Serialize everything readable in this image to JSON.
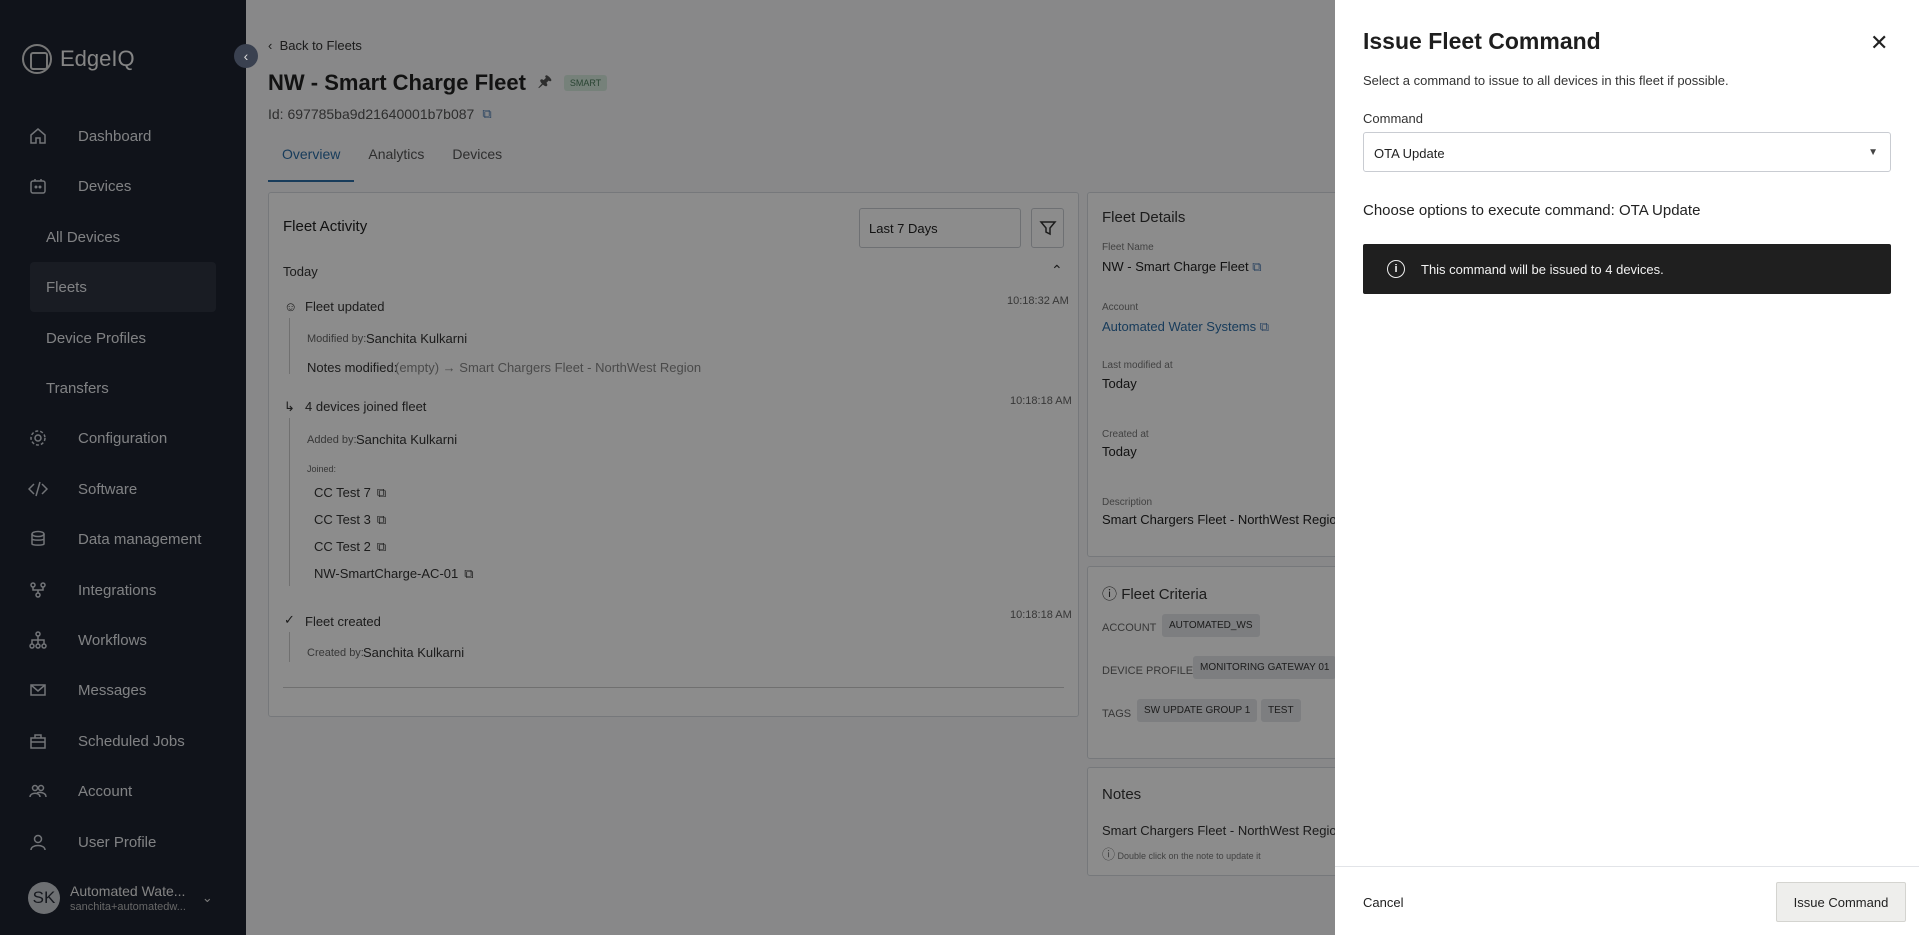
{
  "app": {
    "brand": "EdgeIQ"
  },
  "sidebar": {
    "items": [
      {
        "label": "Dashboard",
        "icon": "home-icon"
      },
      {
        "label": "Devices",
        "icon": "devices-icon"
      },
      {
        "label": "Configuration",
        "icon": "gear-icon"
      },
      {
        "label": "Software",
        "icon": "code-icon"
      },
      {
        "label": "Data management",
        "icon": "database-icon"
      },
      {
        "label": "Integrations",
        "icon": "integrations-icon"
      },
      {
        "label": "Workflows",
        "icon": "workflow-icon"
      },
      {
        "label": "Messages",
        "icon": "mail-icon"
      },
      {
        "label": "Scheduled Jobs",
        "icon": "briefcase-icon"
      },
      {
        "label": "Account",
        "icon": "people-icon"
      },
      {
        "label": "User Profile",
        "icon": "user-icon"
      }
    ],
    "sub_items": [
      "All Devices",
      "Fleets",
      "Device Profiles",
      "Transfers"
    ],
    "user": {
      "initials": "SK",
      "name": "Automated Wate...",
      "email": "sanchita+automatedw..."
    }
  },
  "page": {
    "back": "Back to Fleets",
    "title": "NW - Smart Charge Fleet",
    "badge": "SMART",
    "id_text": "Id: 697785ba9d21640001b7b087",
    "tabs": [
      "Overview",
      "Analytics",
      "Devices"
    ]
  },
  "activity": {
    "title": "Fleet Activity",
    "range": "Last 7 Days",
    "group": "Today",
    "events": {
      "updated": {
        "title": "Fleet updated",
        "time": "10:18:32 AM",
        "modified_by_label": "Modified by:",
        "modified_by": "Sanchita Kulkarni",
        "notes_label": "Notes modified:",
        "notes_from": "(empty) → Smart Chargers Fleet - NorthWest Region"
      },
      "joined": {
        "title": "4 devices joined fleet",
        "time": "10:18:18 AM",
        "added_by_label": "Added by:",
        "added_by": "Sanchita Kulkarni",
        "joined_label": "Joined:",
        "devices": [
          "CC Test 7",
          "CC Test 3",
          "CC Test 2",
          "NW-SmartCharge-AC-01"
        ]
      },
      "created": {
        "title": "Fleet created",
        "time": "10:18:18 AM",
        "created_by_label": "Created by:",
        "created_by": "Sanchita Kulkarni"
      }
    }
  },
  "details": {
    "title": "Fleet Details",
    "fleet_name_label": "Fleet Name",
    "fleet_name": "NW - Smart Charge Fleet",
    "account_label": "Account",
    "account": "Automated Water Systems",
    "last_modified_label": "Last modified at",
    "last_modified": "Today",
    "created_label": "Created at",
    "created": "Today",
    "description_label": "Description",
    "description": "Smart Chargers Fleet - NorthWest Region"
  },
  "criteria": {
    "title": "Fleet Criteria",
    "account_label": "ACCOUNT",
    "account": "AUTOMATED_WS",
    "profile_label": "DEVICE PROFILE",
    "profile": "MONITORING GATEWAY 01",
    "tags_label": "TAGS",
    "tags": [
      "SW UPDATE GROUP 1",
      "TEST"
    ]
  },
  "notes": {
    "title": "Notes",
    "text": "Smart Chargers Fleet - NorthWest Region",
    "hint": "Double click on the note to update it"
  },
  "drawer": {
    "title": "Issue Fleet Command",
    "subtitle": "Select a command to issue to all devices in this fleet if possible.",
    "command_label": "Command",
    "command_value": "OTA Update",
    "options_title": "Choose options to execute command: OTA Update",
    "info": "This command will be issued to 4 devices.",
    "cancel": "Cancel",
    "submit": "Issue Command"
  }
}
